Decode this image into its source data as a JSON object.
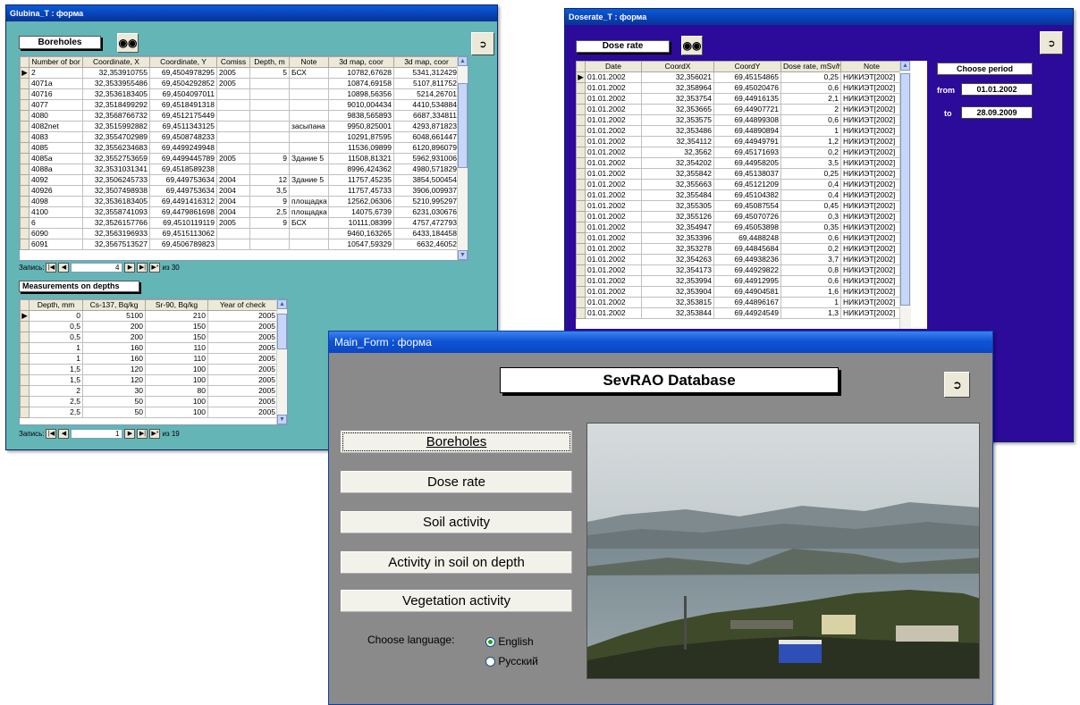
{
  "glubina": {
    "title": "Glubina_T : форма",
    "header_label": "Boreholes",
    "columns": [
      "Number of bor",
      "Coordinate, X",
      "Coordinate, Y",
      "Comiss",
      "Depth, m",
      "Note",
      "3d map, coor",
      "3d map, coor"
    ],
    "rows": [
      [
        "2",
        "32,353910755",
        "69,4504978295",
        "2005",
        "5",
        "БСХ",
        "10782,67628",
        "5341,312429"
      ],
      [
        "4071a",
        "32,3533955486",
        "69,4504292852",
        "2005",
        "",
        "",
        "10874,69158",
        "5107,811752"
      ],
      [
        "40716",
        "32,3536183405",
        "69,4504097011",
        "",
        "",
        "",
        "10898,56356",
        "5214,26701"
      ],
      [
        "4077",
        "32,3518499292",
        "69,4518491318",
        "",
        "",
        "",
        "9010,004434",
        "4410,534884"
      ],
      [
        "4080",
        "32,3568766732",
        "69,4512175449",
        "",
        "",
        "",
        "9838,565893",
        "6687,334811"
      ],
      [
        "4082net",
        "32,3515992882",
        "69,4511343125",
        "",
        "",
        "засыпана",
        "9950,825001",
        "4293,871823"
      ],
      [
        "4083",
        "32,3554702989",
        "69,4508748233",
        "",
        "",
        "",
        "10291,87595",
        "6048,661447"
      ],
      [
        "4085",
        "32,3556234683",
        "69,4499249948",
        "",
        "",
        "",
        "11536,09899",
        "6120,896079"
      ],
      [
        "4085a",
        "32,3552753659",
        "69,4499445789",
        "2005",
        "9",
        "Здание 5",
        "11508,81321",
        "5962,931006"
      ],
      [
        "4088a",
        "32,3531031341",
        "69,4518589238",
        "",
        "",
        "",
        "8996,424362",
        "4980,571829"
      ],
      [
        "4092",
        "32,3506245733",
        "69,449753634",
        "2004",
        "12",
        "Здание 5",
        "11757,45235",
        "3854,500454"
      ],
      [
        "40926",
        "32,3507498938",
        "69,449753634",
        "2004",
        "3,5",
        "",
        "11757,45733",
        "3906,009937"
      ],
      [
        "4098",
        "32,3536183405",
        "69,4491416312",
        "2004",
        "9",
        "площадка Т",
        "12562,06306",
        "5210,995297"
      ],
      [
        "4100",
        "32,3558741093",
        "69,4479861698",
        "2004",
        "2,5",
        "площадка Т",
        "14075,6739",
        "6231,030676"
      ],
      [
        "6",
        "32,3526157766",
        "69,4510119119",
        "2005",
        "9",
        "БСХ",
        "10111,08399",
        "4757,472793"
      ],
      [
        "6090",
        "32,3563196933",
        "69,4515113062",
        "",
        "",
        "",
        "9460,163265",
        "6433,184458"
      ],
      [
        "6091",
        "32,3567513527",
        "69,4506789823",
        "",
        "",
        "",
        "10547,59329",
        "6632,46052"
      ]
    ],
    "record_label": "Запись:",
    "record_num": "4",
    "record_of": "из 30",
    "depth_label": "Measurements on depths",
    "depth_columns": [
      "Depth, mm",
      "Cs-137, Bq/kg",
      "Sr-90, Bq/kg",
      "Year of check"
    ],
    "depth_rows": [
      [
        "0",
        "5100",
        "210",
        "2005"
      ],
      [
        "0,5",
        "200",
        "150",
        "2005"
      ],
      [
        "0,5",
        "200",
        "150",
        "2005"
      ],
      [
        "1",
        "160",
        "110",
        "2005"
      ],
      [
        "1",
        "160",
        "110",
        "2005"
      ],
      [
        "1,5",
        "120",
        "100",
        "2005"
      ],
      [
        "1,5",
        "120",
        "100",
        "2005"
      ],
      [
        "2",
        "30",
        "80",
        "2005"
      ],
      [
        "2,5",
        "50",
        "100",
        "2005"
      ],
      [
        "2,5",
        "50",
        "100",
        "2005"
      ]
    ],
    "depth_record_num": "1",
    "depth_record_of": "из 19"
  },
  "doserate": {
    "title": "Doserate_T : форма",
    "header_label": "Dose rate",
    "columns": [
      "Date",
      "CoordX",
      "CoordY",
      "Dose rate, mSv/h",
      "Note"
    ],
    "rows": [
      [
        "01.01.2002",
        "32,356021",
        "69,45154865",
        "0,25",
        "НИКИЭТ[2002]"
      ],
      [
        "01.01.2002",
        "32,358964",
        "69,45020476",
        "0,6",
        "НИКИЭТ[2002]"
      ],
      [
        "01.01.2002",
        "32,353754",
        "69,44916135",
        "2,1",
        "НИКИЭТ[2002]"
      ],
      [
        "01.01.2002",
        "32,353665",
        "69,44907721",
        "2",
        "НИКИЭТ[2002]"
      ],
      [
        "01.01.2002",
        "32,353575",
        "69,44899308",
        "0,6",
        "НИКИЭТ[2002]"
      ],
      [
        "01.01.2002",
        "32,353486",
        "69,44890894",
        "1",
        "НИКИЭТ[2002]"
      ],
      [
        "01.01.2002",
        "32,354112",
        "69,44949791",
        "1,2",
        "НИКИЭТ[2002]"
      ],
      [
        "01.01.2002",
        "32,3562",
        "69,45171693",
        "0,2",
        "НИКИЭТ[2002]"
      ],
      [
        "01.01.2002",
        "32,354202",
        "69,44958205",
        "3,5",
        "НИКИЭТ[2002]"
      ],
      [
        "01.01.2002",
        "32,355842",
        "69,45138037",
        "0,25",
        "НИКИЭТ[2002]"
      ],
      [
        "01.01.2002",
        "32,355663",
        "69,45121209",
        "0,4",
        "НИКИЭТ[2002]"
      ],
      [
        "01.01.2002",
        "32,355484",
        "69,45104382",
        "0,4",
        "НИКИЭТ[2002]"
      ],
      [
        "01.01.2002",
        "32,355305",
        "69,45087554",
        "0,45",
        "НИКИЭТ[2002]"
      ],
      [
        "01.01.2002",
        "32,355126",
        "69,45070726",
        "0,3",
        "НИКИЭТ[2002]"
      ],
      [
        "01.01.2002",
        "32,354947",
        "69,45053898",
        "0,35",
        "НИКИЭТ[2002]"
      ],
      [
        "01.01.2002",
        "32,353396",
        "69,4488248",
        "0,6",
        "НИКИЭТ[2002]"
      ],
      [
        "01.01.2002",
        "32,353278",
        "69,44845684",
        "0,2",
        "НИКИЭТ[2002]"
      ],
      [
        "01.01.2002",
        "32,354263",
        "69,44938236",
        "3,7",
        "НИКИЭТ[2002]"
      ],
      [
        "01.01.2002",
        "32,354173",
        "69,44929822",
        "0,8",
        "НИКИЭТ[2002]"
      ],
      [
        "01.01.2002",
        "32,353994",
        "69,44912995",
        "0,6",
        "НИКИЭТ[2002]"
      ],
      [
        "01.01.2002",
        "32,353904",
        "69,44904581",
        "1,6",
        "НИКИЭТ[2002]"
      ],
      [
        "01.01.2002",
        "32,353815",
        "69,44896167",
        "1",
        "НИКИЭТ[2002]"
      ],
      [
        "01.01.2002",
        "32,353844",
        "69,44924549",
        "1,3",
        "НИКИЭТ[2002]"
      ]
    ],
    "choose_period": "Choose period",
    "from_label": "from",
    "from_value": "01.01.2002",
    "to_label": "to",
    "to_value": "28.09.2009"
  },
  "main": {
    "title": "Main_Form : форма",
    "db_title": "SevRAO Database",
    "buttons": [
      "Boreholes",
      "Dose rate",
      "Soil activity",
      "Activity in soil on depth",
      "Vegetation activity"
    ],
    "choose_language": "Choose language:",
    "lang_english": "English",
    "lang_russian": "Русский"
  },
  "colors": {
    "glubina_bg": "#64b5b6",
    "doserate_bg": "#2c0a9a",
    "main_bg": "#8a8a8a",
    "titlebar": "#0841b4"
  }
}
